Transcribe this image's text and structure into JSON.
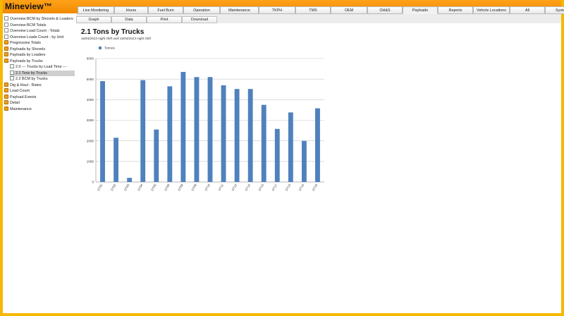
{
  "app": {
    "title": "Mineview™"
  },
  "tabs": [
    {
      "label": "Live Monitoring"
    },
    {
      "label": "Hours"
    },
    {
      "label": "Fuel Burn"
    },
    {
      "label": "Operation"
    },
    {
      "label": "Maintenance"
    },
    {
      "label": "TKPH"
    },
    {
      "label": "TMS"
    },
    {
      "label": "OEM"
    },
    {
      "label": "OH&S"
    },
    {
      "label": "Payloads",
      "active": true
    },
    {
      "label": "Reports"
    },
    {
      "label": "Vehicle Locations"
    },
    {
      "label": "All"
    },
    {
      "label": "System"
    }
  ],
  "subtabs": [
    {
      "label": "Graph",
      "active": true
    },
    {
      "label": "Data"
    },
    {
      "label": "Print"
    },
    {
      "label": "Download"
    }
  ],
  "sidebar": {
    "items": [
      {
        "label": "Overview BCM by Shovels & Loaders",
        "icon": "doc-icon",
        "level": 0
      },
      {
        "label": "Overview BCM Totals",
        "icon": "doc-icon",
        "level": 0
      },
      {
        "label": "Overview Load Count - Totals",
        "icon": "doc-icon",
        "level": 0
      },
      {
        "label": "Overview Loads Count - by Unit",
        "icon": "doc-icon",
        "level": 0
      },
      {
        "label": "Progressive Totals",
        "icon": "folder-icon",
        "level": 0
      },
      {
        "label": "Payloads by Shovels",
        "icon": "folder-icon",
        "level": 0
      },
      {
        "label": "Payloads by Loaders",
        "icon": "folder-icon",
        "level": 0
      },
      {
        "label": "Payloads by Trucks",
        "icon": "folder-icon",
        "level": 0
      },
      {
        "label": "2.0 --- Trucks by Load Time ---",
        "icon": "doc-icon",
        "level": 1
      },
      {
        "label": "2.1 Tons by Trucks",
        "icon": "doc-icon",
        "level": 1,
        "selected": true
      },
      {
        "label": "2.2 BCM by Trucks",
        "icon": "doc-icon",
        "level": 1
      },
      {
        "label": "Dig & Haul - Rates",
        "icon": "folder-icon",
        "level": 0
      },
      {
        "label": "Load Count",
        "icon": "folder-icon",
        "level": 0
      },
      {
        "label": "Payload Events",
        "icon": "folder-icon",
        "level": 0
      },
      {
        "label": "Detail",
        "icon": "folder-icon",
        "level": 0
      },
      {
        "label": "Maintenance",
        "icon": "folder-icon",
        "level": 0
      }
    ]
  },
  "page": {
    "title": "2.1 Tons by Trucks",
    "subtitle": "16/04/2013 night shift until 16/04/2013 night shift"
  },
  "colors": {
    "accent": "#f7b800",
    "bar": "#4f81bd"
  },
  "chart_data": {
    "type": "bar",
    "categories": [
      "DT01",
      "DT02",
      "DT03",
      "DT04",
      "DT05",
      "DT06",
      "DT08",
      "DT09",
      "DT10",
      "DT11",
      "DT12",
      "DT14",
      "DT15",
      "DT17",
      "DT13",
      "DT14",
      "DT16"
    ],
    "series": [
      {
        "name": "Tonnes",
        "values": [
          4900,
          2150,
          200,
          4950,
          2550,
          4650,
          5350,
          5100,
          5100,
          4700,
          4520,
          4520,
          3750,
          2580,
          3380,
          2000,
          3580
        ]
      }
    ],
    "ylim": [
      0,
      6000
    ],
    "yticks": [
      0,
      1000,
      2000,
      3000,
      4000,
      5000,
      6000
    ],
    "grid": true,
    "legend": "top-left"
  }
}
